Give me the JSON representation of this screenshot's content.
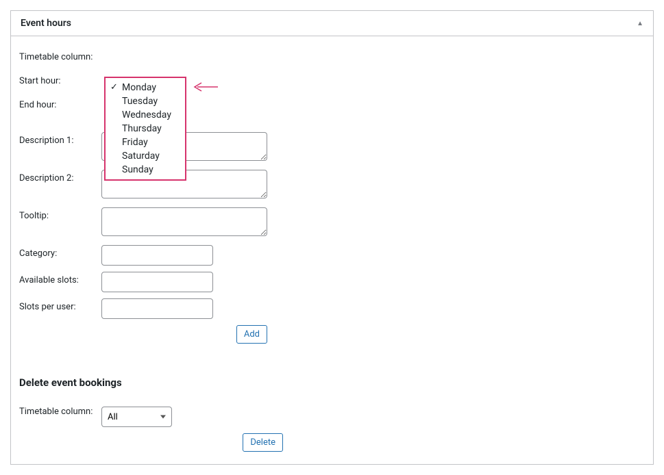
{
  "metabox": {
    "title": "Event hours"
  },
  "labels": {
    "timetable_column": "Timetable column:",
    "start_hour": "Start hour:",
    "end_hour": "End hour:",
    "description1": "Description 1:",
    "description2": "Description 2:",
    "tooltip": "Tooltip:",
    "category": "Category:",
    "available_slots": "Available slots:",
    "slots_per_user": "Slots per user:"
  },
  "values": {
    "timetable_column": "Monday",
    "start_hour": "",
    "end_hour": "",
    "description1": "",
    "description2": "",
    "tooltip": "",
    "category": "",
    "available_slots": "",
    "slots_per_user": ""
  },
  "dropdown": {
    "options": [
      "Monday",
      "Tuesday",
      "Wednesday",
      "Thursday",
      "Friday",
      "Saturday",
      "Sunday"
    ]
  },
  "buttons": {
    "add": "Add",
    "delete": "Delete"
  },
  "delete_section": {
    "heading": "Delete event bookings",
    "label": "Timetable column:",
    "value": "All"
  }
}
